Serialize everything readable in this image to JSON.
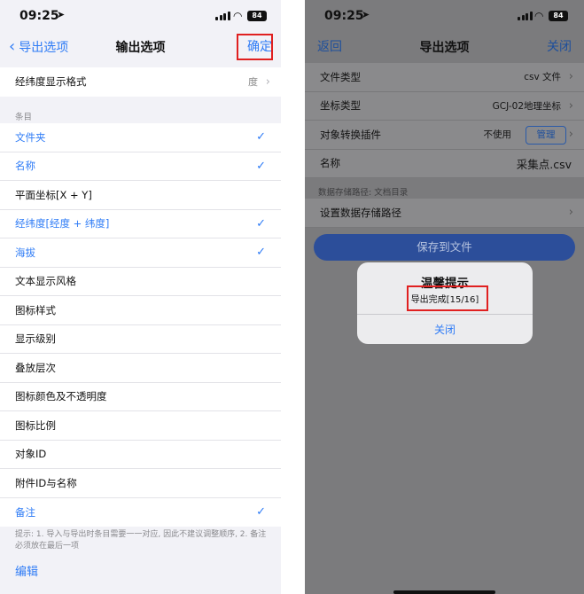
{
  "left": {
    "status": {
      "time": "09:25",
      "battery": "84"
    },
    "nav": {
      "back_label": "导出选项",
      "title": "输出选项",
      "confirm_label": "确定"
    },
    "format_row": {
      "label": "经纬度显示格式",
      "value": "度"
    },
    "section_label": "条目",
    "items": [
      {
        "label": "文件夹",
        "checked": true
      },
      {
        "label": "名称",
        "checked": true
      },
      {
        "label": "平面坐标[X + Y]",
        "checked": false
      },
      {
        "label": "经纬度[经度 + 纬度]",
        "checked": true
      },
      {
        "label": "海拔",
        "checked": true
      },
      {
        "label": "文本显示风格",
        "checked": false
      },
      {
        "label": "图标样式",
        "checked": false
      },
      {
        "label": "显示级别",
        "checked": false
      },
      {
        "label": "叠放层次",
        "checked": false
      },
      {
        "label": "图标颜色及不透明度",
        "checked": false
      },
      {
        "label": "图标比例",
        "checked": false
      },
      {
        "label": "对象ID",
        "checked": false
      },
      {
        "label": "附件ID与名称",
        "checked": false
      },
      {
        "label": "备注",
        "checked": true
      }
    ],
    "hint": "提示: 1. 导入与导出时条目需要一一对应, 因此不建议调整顺序, 2. 备注必须放在最后一项",
    "edit_label": "编辑"
  },
  "right": {
    "status": {
      "time": "09:25",
      "battery": "84"
    },
    "nav": {
      "back_label": "返回",
      "title": "导出选项",
      "close_label": "关闭"
    },
    "rows": [
      {
        "label": "文件类型",
        "value": "csv 文件"
      },
      {
        "label": "坐标类型",
        "value": "GCJ-02地理坐标"
      },
      {
        "label": "对象转换插件",
        "value": "不使用",
        "button": "管理"
      },
      {
        "label": "名称",
        "value": "采集点.csv"
      }
    ],
    "path_section_label": "数据存储路径: 文档目录",
    "path_row_label": "设置数据存储路径",
    "save_button": "保存到文件",
    "alert": {
      "title": "温馨提示",
      "message": "导出完成[15/16]",
      "button": "关闭"
    }
  },
  "colors": {
    "accent": "#2f7cf6",
    "highlight_box": "#e02020",
    "dim_overlay": "#7b7b7d"
  }
}
